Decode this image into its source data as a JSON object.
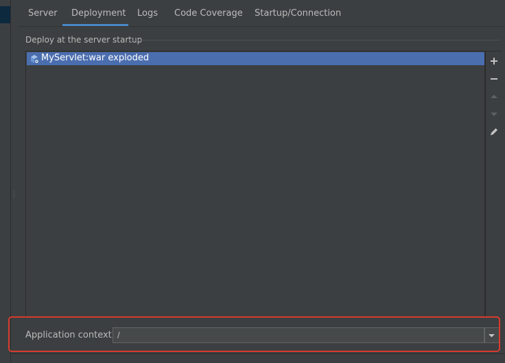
{
  "tabs": [
    {
      "label": "Server"
    },
    {
      "label": "Deployment"
    },
    {
      "label": "Logs"
    },
    {
      "label": "Code Coverage"
    },
    {
      "label": "Startup/Connection"
    }
  ],
  "active_tab": "Deployment",
  "deploy": {
    "group_title": "Deploy at the server startup",
    "items": [
      {
        "label": "MyServlet:war exploded",
        "icon": "artifact-icon",
        "selected": true
      }
    ],
    "toolbar": [
      "add-icon",
      "remove-icon",
      "move-up-icon",
      "move-down-icon",
      "edit-icon"
    ]
  },
  "context": {
    "label": "Application context:",
    "value": "/"
  },
  "colors": {
    "background": "#3c3f41",
    "selection": "#4b6eaf",
    "tab_underline": "#4a88c7",
    "highlight_border": "#d83b2e"
  }
}
